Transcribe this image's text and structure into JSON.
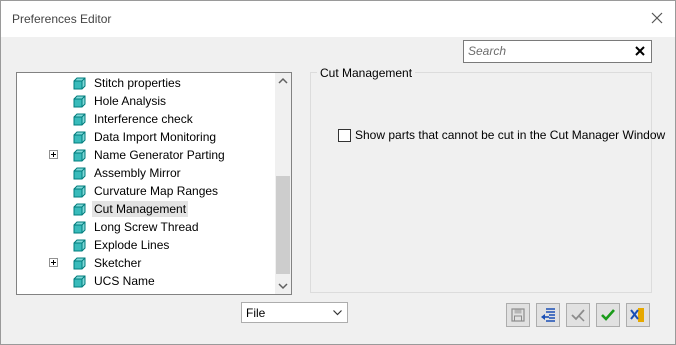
{
  "window": {
    "title": "Preferences Editor"
  },
  "search": {
    "placeholder": "Search"
  },
  "tree": {
    "items": [
      {
        "label": "Stitch properties",
        "expandable": false,
        "selected": false
      },
      {
        "label": "Hole Analysis",
        "expandable": false,
        "selected": false
      },
      {
        "label": "Interference check",
        "expandable": false,
        "selected": false
      },
      {
        "label": "Data Import Monitoring",
        "expandable": false,
        "selected": false
      },
      {
        "label": "Name Generator Parting",
        "expandable": true,
        "selected": false
      },
      {
        "label": "Assembly Mirror",
        "expandable": false,
        "selected": false
      },
      {
        "label": "Curvature Map Ranges",
        "expandable": false,
        "selected": false
      },
      {
        "label": "Cut Management",
        "expandable": false,
        "selected": true
      },
      {
        "label": "Long Screw Thread",
        "expandable": false,
        "selected": false
      },
      {
        "label": "Explode Lines",
        "expandable": false,
        "selected": false
      },
      {
        "label": "Sketcher",
        "expandable": true,
        "selected": false
      },
      {
        "label": "UCS Name",
        "expandable": false,
        "selected": false
      }
    ]
  },
  "panel": {
    "title": "Cut Management",
    "option_label": "Show parts that cannot be cut in the Cut Manager Window",
    "option_checked": false
  },
  "scope_select": {
    "value": "File"
  },
  "toolbar": {
    "buttons": [
      "save-icon",
      "import-list-icon",
      "apply-partial-icon",
      "ok-check-icon",
      "cancel-exit-icon"
    ]
  },
  "colors": {
    "accent_green": "#1a9b1a",
    "icon_teal": "#00a3a3",
    "icon_blue": "#1a4fb5",
    "icon_yellow": "#e6a800"
  }
}
